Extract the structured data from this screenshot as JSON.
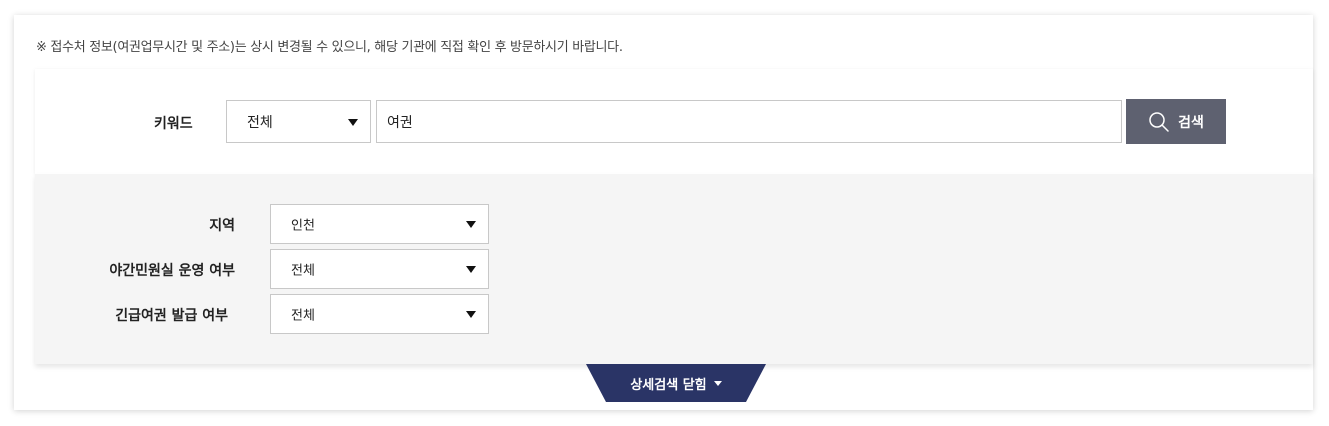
{
  "notice": "※ 접수처 정보(여권업무시간 및 주소)는 상시 변경될 수 있으니, 해당 기관에 직접 확인 후 방문하시기 바랍니다.",
  "keyword": {
    "label": "키워드",
    "scope_select": "전체",
    "input_value": "여권",
    "search_label": "검색"
  },
  "filters": [
    {
      "label": "지역",
      "value": "인천"
    },
    {
      "label": "야간민원실 운영 여부",
      "value": "전체"
    },
    {
      "label": "긴급여권 발급 여부",
      "value": "전체"
    }
  ],
  "toggle": {
    "label": "상세검색 닫힘"
  },
  "colors": {
    "search_button": "#5e6170",
    "toggle_tab": "#2a3466",
    "detail_background": "#f5f5f5"
  },
  "icons": {
    "search": "search-icon",
    "dropdown": "chevron-down-icon"
  }
}
